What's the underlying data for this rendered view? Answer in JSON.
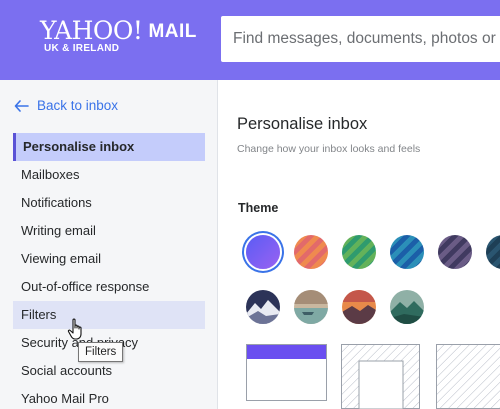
{
  "header": {
    "logo_text": "YAHOO!",
    "logo_mail": "MAIL",
    "logo_region": "UK & IRELAND",
    "search_placeholder": "Find messages, documents, photos or people"
  },
  "sidebar": {
    "back_label": "Back to inbox",
    "items": [
      {
        "label": "Personalise inbox"
      },
      {
        "label": "Mailboxes"
      },
      {
        "label": "Notifications"
      },
      {
        "label": "Writing email"
      },
      {
        "label": "Viewing email"
      },
      {
        "label": "Out-of-office response"
      },
      {
        "label": "Filters"
      },
      {
        "label": "Security and privacy"
      },
      {
        "label": "Social accounts"
      },
      {
        "label": "Yahoo Mail Pro"
      }
    ],
    "tooltip": "Filters"
  },
  "main": {
    "title": "Personalise inbox",
    "subtitle": "Change how your inbox looks and feels",
    "theme_heading": "Theme"
  },
  "colors": {
    "header": "#7b6ff0",
    "accent": "#3a73e8",
    "active_nav": "#c4ccfb"
  }
}
